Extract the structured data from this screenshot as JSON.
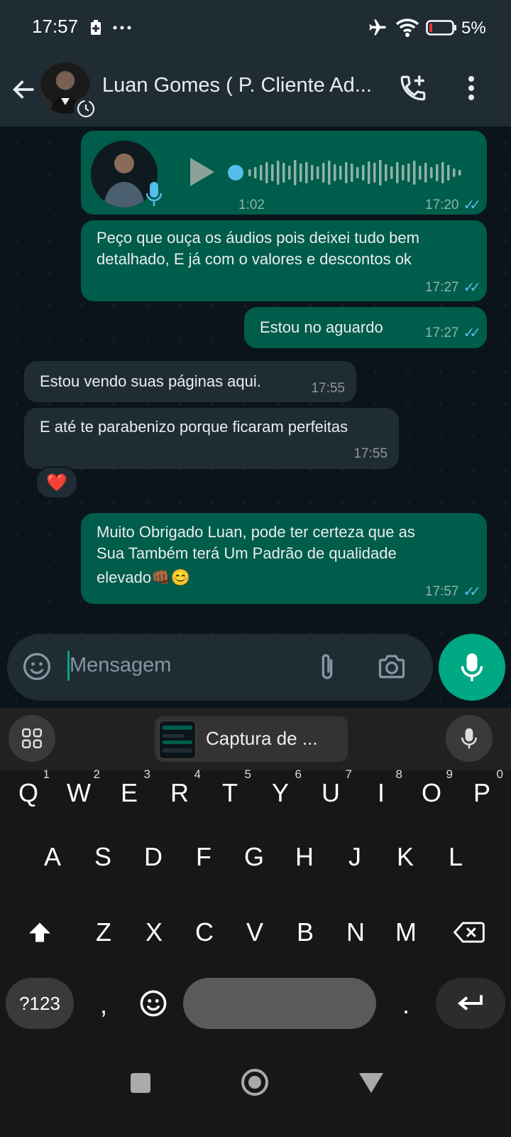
{
  "status": {
    "time": "17:57",
    "battery": "5%"
  },
  "header": {
    "contact_name": "Luan Gomes ( P. Cliente Ad..."
  },
  "messages": {
    "voice": {
      "duration": "1:02",
      "time": "17:20"
    },
    "m1": {
      "line1": "Peço que ouça os áudios pois deixei tudo bem",
      "line2": "detalhado, E já com o valores e descontos ok",
      "time": "17:27"
    },
    "m2": {
      "text": "Estou no aguardo",
      "time": "17:27"
    },
    "m3": {
      "text": "Estou vendo suas páginas aqui.",
      "time": "17:55"
    },
    "m4": {
      "text": "E até te parabenizo porque ficaram perfeitas",
      "time": "17:55",
      "reaction": "❤️"
    },
    "m5": {
      "line1": "Muito Obrigado Luan, pode ter certeza que as",
      "line2": "Sua Também terá Um Padrão de qualidade",
      "line3": "elevado",
      "emoji": "👊🏾😊",
      "time": "17:57"
    }
  },
  "input": {
    "placeholder": "Mensagem"
  },
  "keyboard": {
    "clipboard_label": "Captura de ...",
    "row1": [
      "Q",
      "W",
      "E",
      "R",
      "T",
      "Y",
      "U",
      "I",
      "O",
      "P"
    ],
    "row1_hints": [
      "1",
      "2",
      "3",
      "4",
      "5",
      "6",
      "7",
      "8",
      "9",
      "0"
    ],
    "row2": [
      "A",
      "S",
      "D",
      "F",
      "G",
      "H",
      "J",
      "K",
      "L"
    ],
    "row3": [
      "Z",
      "X",
      "C",
      "V",
      "B",
      "N",
      "M"
    ],
    "symbols_key": "?123",
    "comma": ",",
    "period": "."
  },
  "colors": {
    "accent": "#00a884",
    "outgoing": "#005c4b",
    "incoming": "#1f2c34",
    "read_ticks": "#53bdeb"
  }
}
